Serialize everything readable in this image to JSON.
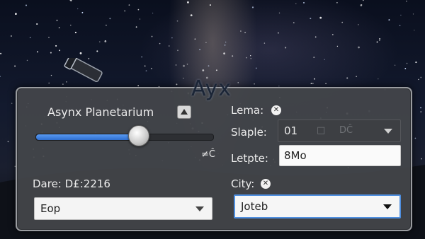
{
  "overlay_title": "Ayx",
  "panel": {
    "heading": "Asynx Planetarium",
    "slider": {
      "fraction": 0.58,
      "glyph": "≠Ĉ"
    },
    "date_label": "Dare: D£:2216",
    "left_dropdown": {
      "value": "Eop"
    },
    "lema_label": "Lema:",
    "slaple": {
      "label": "Slaple:",
      "value": "01",
      "ghost_a": "□",
      "ghost_b": "DĈ"
    },
    "letpte": {
      "label": "Letpte:",
      "value": "8Mo"
    },
    "city_label": "City:",
    "city_dropdown": {
      "value": "Joteb"
    }
  },
  "colors": {
    "accent": "#3a7de0",
    "panel_bg": "#44464a"
  },
  "icons": {
    "collapse": "caret-up-icon",
    "clear": "close-circle-icon",
    "dropdown": "chevron-down-icon",
    "telescope": "telescope-icon"
  }
}
